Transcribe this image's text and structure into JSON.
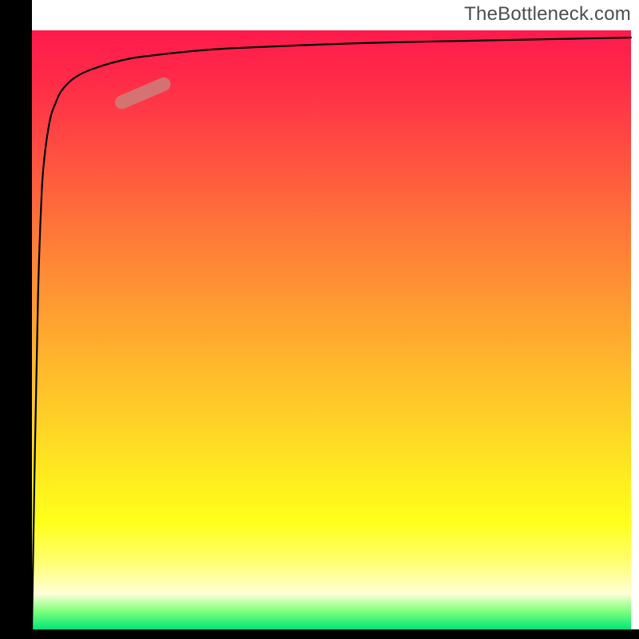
{
  "attribution": "TheBottleneck.com",
  "chart_data": {
    "type": "line",
    "title": "",
    "xlabel": "",
    "ylabel": "",
    "xlim": [
      0,
      100
    ],
    "ylim": [
      0,
      100
    ],
    "grid": false,
    "series": [
      {
        "name": "bottleneck-curve",
        "x": [
          0,
          0.5,
          1,
          1.5,
          2,
          3,
          4,
          5,
          7,
          10,
          15,
          20,
          30,
          40,
          50,
          60,
          70,
          80,
          90,
          100
        ],
        "y": [
          0,
          30,
          55,
          70,
          78,
          85,
          88,
          90,
          92,
          93.5,
          95,
          95.8,
          96.8,
          97.3,
          97.7,
          98,
          98.2,
          98.4,
          98.6,
          98.8
        ]
      }
    ],
    "highlight": {
      "x_range": [
        15,
        22
      ],
      "y_range": [
        88,
        91
      ]
    },
    "gradient_stops": [
      {
        "pos": 0,
        "color": "#ff1a4d"
      },
      {
        "pos": 0.22,
        "color": "#ff5440"
      },
      {
        "pos": 0.54,
        "color": "#ffb22d"
      },
      {
        "pos": 0.82,
        "color": "#ffff1a"
      },
      {
        "pos": 1.0,
        "color": "#00e676"
      }
    ]
  }
}
